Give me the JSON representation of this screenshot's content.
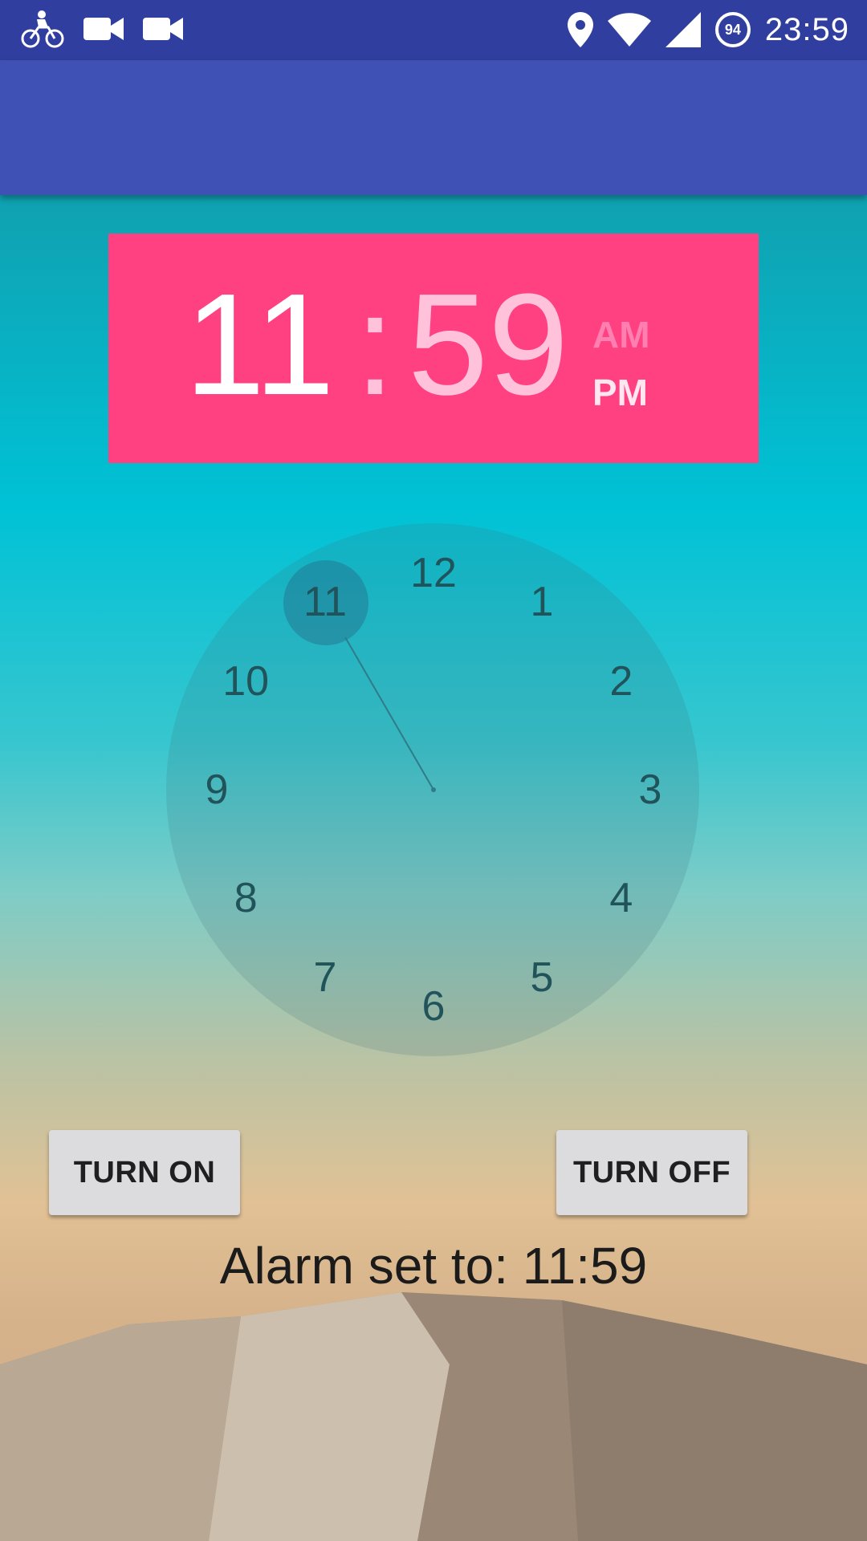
{
  "status_bar": {
    "time": "23:59",
    "battery_level": "94",
    "icons": [
      "bicycle-icon",
      "video-camera-icon",
      "video-camera-icon",
      "location-icon",
      "wifi-icon",
      "cell-signal-icon",
      "battery-icon"
    ]
  },
  "app_bar": {
    "title": ""
  },
  "time_picker": {
    "hour": "11",
    "separator": ":",
    "minute": "59",
    "am_label": "AM",
    "pm_label": "PM",
    "selected_period": "PM",
    "selected_hour": 11,
    "clock_numbers": [
      "12",
      "1",
      "2",
      "3",
      "4",
      "5",
      "6",
      "7",
      "8",
      "9",
      "10",
      "11"
    ]
  },
  "buttons": {
    "turn_on": "TURN ON",
    "turn_off": "TURN OFF"
  },
  "alarm_status": "Alarm set to: 11:59",
  "colors": {
    "status_bar": "#303f9f",
    "app_bar": "#3f51b5",
    "accent": "#ff4081",
    "button": "#dcdbdd"
  }
}
